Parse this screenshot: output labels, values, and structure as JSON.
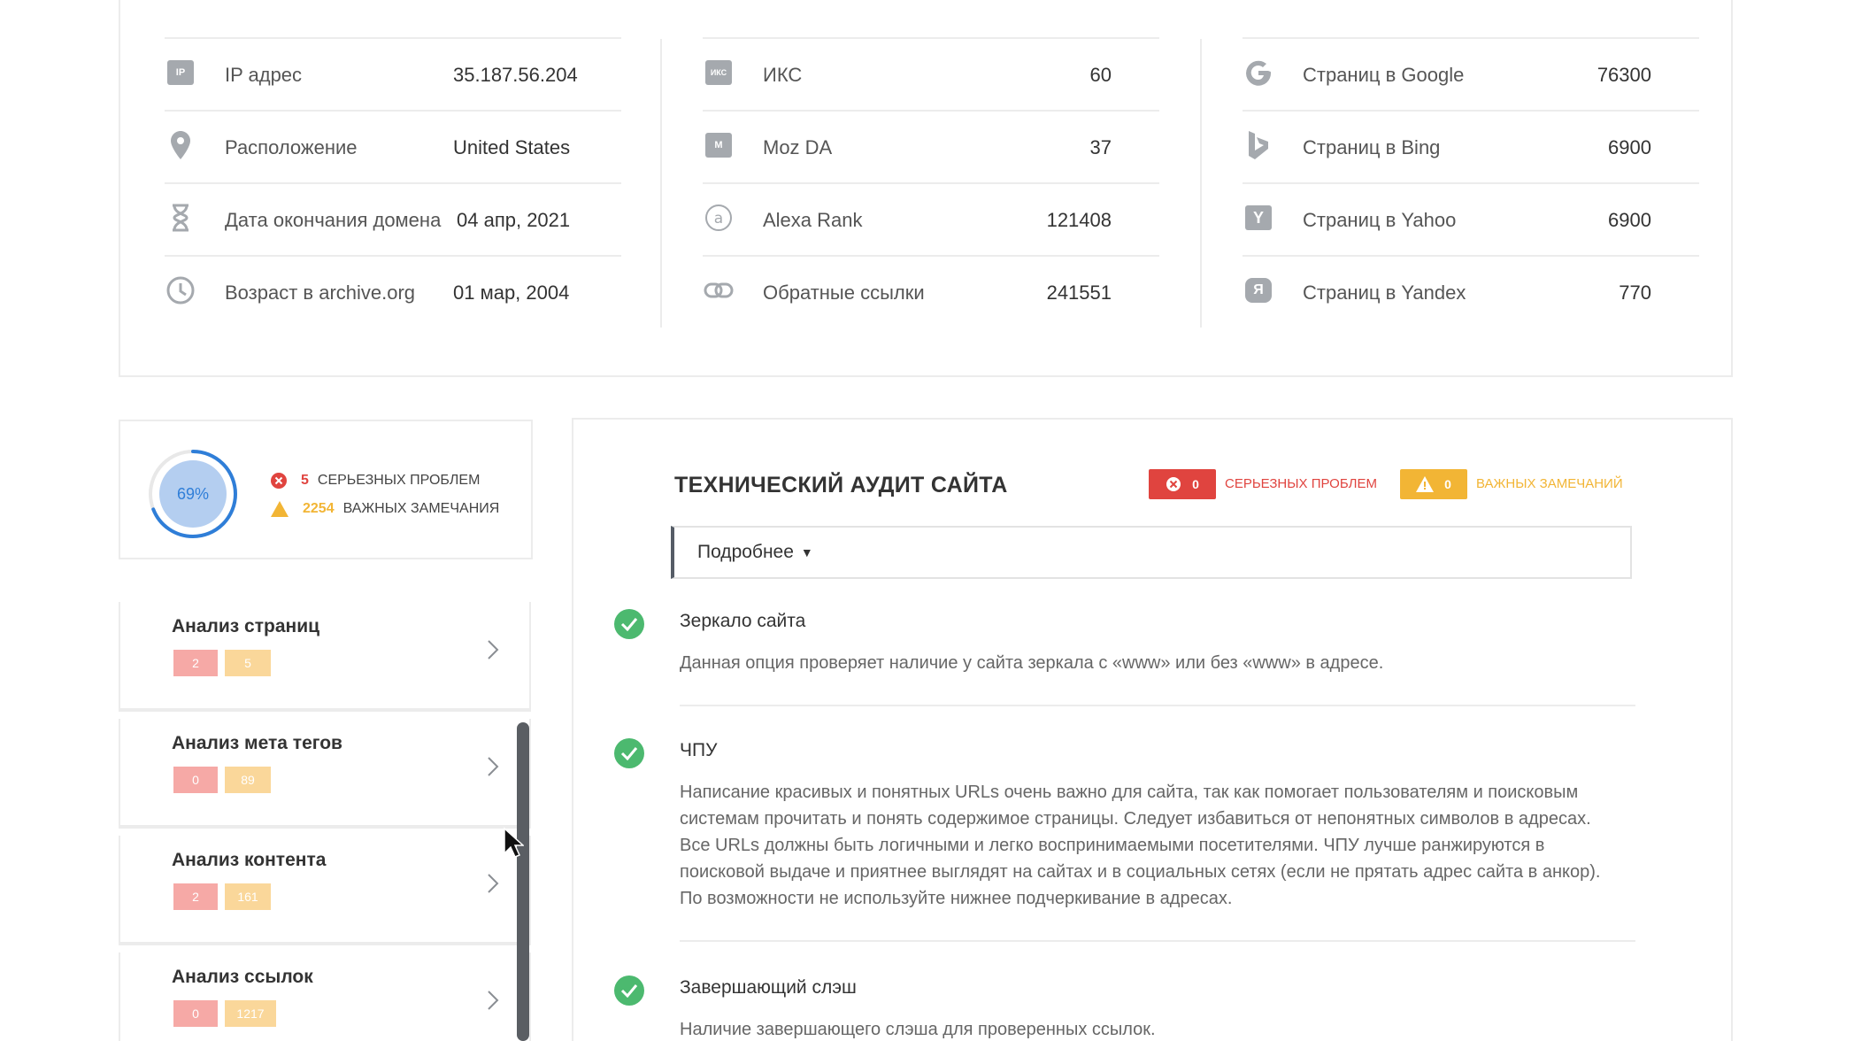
{
  "stats": {
    "col1": [
      {
        "icon": "ip-icon",
        "label": "IP адрес",
        "value": "35.187.56.204"
      },
      {
        "icon": "location-pin-icon",
        "label": "Расположение",
        "value": "United States"
      },
      {
        "icon": "hourglass-icon",
        "label": "Дата окончания домена",
        "value": "04 апр, 2021"
      },
      {
        "icon": "clock-icon",
        "label": "Возраст в archive.org",
        "value": "01 мар, 2004"
      }
    ],
    "col2": [
      {
        "icon": "iks-icon",
        "label": "ИКС",
        "value": "60"
      },
      {
        "icon": "moz-icon",
        "label": "Moz DA",
        "value": "37"
      },
      {
        "icon": "alexa-icon",
        "label": "Alexa Rank",
        "value": "121408"
      },
      {
        "icon": "link-icon",
        "label": "Обратные ссылки",
        "value": "241551"
      }
    ],
    "col3": [
      {
        "icon": "google-icon",
        "label": "Страниц в Google",
        "value": "76300"
      },
      {
        "icon": "bing-icon",
        "label": "Страниц в Bing",
        "value": "6900"
      },
      {
        "icon": "yahoo-icon",
        "label": "Страниц в Yahoo",
        "value": "6900"
      },
      {
        "icon": "yandex-icon",
        "label": "Страниц в Yandex",
        "value": "770"
      }
    ],
    "badge_ip": "IP",
    "badge_iks": "ИКС",
    "badge_moz": "M",
    "badge_yahoo": "Y",
    "badge_yandex": "Я"
  },
  "score": {
    "percent_label": "69%",
    "percent_value": 0.69,
    "serious_count": "5",
    "serious_label": "СЕРЬЕЗНЫХ ПРОБЛЕМ",
    "important_count": "2254",
    "important_label": "ВАЖНЫХ ЗАМЕЧАНИЯ"
  },
  "sidebar": {
    "items": [
      {
        "title": "Анализ страниц",
        "errors": "2",
        "warnings": "5"
      },
      {
        "title": "Анализ мета тегов",
        "errors": "0",
        "warnings": "89"
      },
      {
        "title": "Анализ контента",
        "errors": "2",
        "warnings": "161"
      },
      {
        "title": "Анализ ссылок",
        "errors": "0",
        "warnings": "1217"
      }
    ]
  },
  "audit": {
    "title": "ТЕХНИЧЕСКИЙ АУДИТ САЙТА",
    "errors_count": "0",
    "errors_label": "СЕРЬЕЗНЫХ ПРОБЛЕМ",
    "warnings_count": "0",
    "warnings_label": "ВАЖНЫХ ЗАМЕЧАНИЙ",
    "details_label": "Подробнее",
    "details_arrow": "▼",
    "items": [
      {
        "title": "Зеркало сайта",
        "desc": "Данная опция проверяет наличие у сайта зеркала с «www» или без «www» в адресе."
      },
      {
        "title": "ЧПУ",
        "desc": "Написание красивых и понятных URLs очень важно для сайта, так как помогает пользователям и поисковым системам прочитать и понять содержимое страницы. Следует избавиться от непонятных символов в адресах. Все URLs должны быть логичными и легко воспринимаемыми посетителями. ЧПУ лучше ранжируются в поисковой выдаче и приятнее выглядят на сайтах и в социальных сетях (если не прятать адрес сайта в анкор). По возможности не используйте нижнее подчеркивание в адресах."
      },
      {
        "title": "Завершающий слэш",
        "desc": "Наличие завершающего слэша для проверенных ссылок."
      }
    ]
  },
  "colors": {
    "error_red": "#e0443f",
    "warning_yellow": "#f2b535",
    "success_green": "#4cb96f",
    "gauge_blue": "#2f7ed8"
  }
}
